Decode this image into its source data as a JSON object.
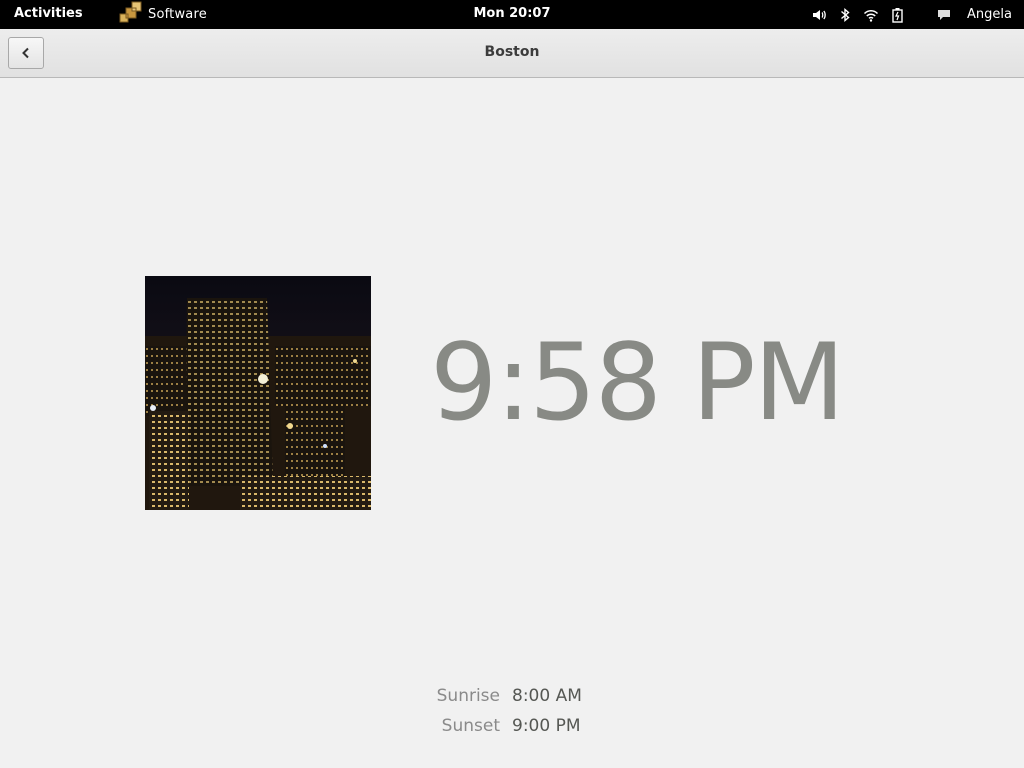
{
  "topbar": {
    "activities": "Activities",
    "app_name": "Software",
    "clock": "Mon 20:07",
    "user": "Angela",
    "icons": [
      "volume-icon",
      "bluetooth-icon",
      "wifi-icon",
      "battery-icon",
      "chat-icon"
    ]
  },
  "header": {
    "title": "Boston",
    "back_icon": "chevron-left-icon"
  },
  "city": {
    "image": "boston-night-skyline",
    "time": "9:58 PM",
    "sunrise_label": "Sunrise",
    "sunrise_value": "8:00 AM",
    "sunset_label": "Sunset",
    "sunset_value": "9:00 PM"
  },
  "colors": {
    "topbar_bg": "#000000",
    "time_color": "#888a85",
    "page_bg": "#f1f1f1"
  }
}
